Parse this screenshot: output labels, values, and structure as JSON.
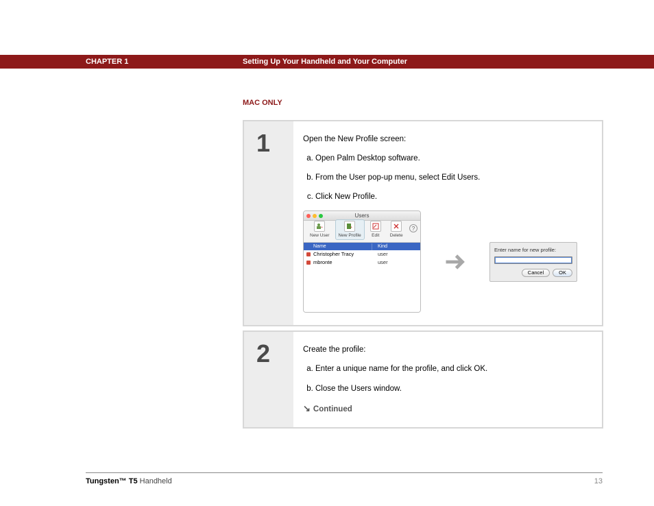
{
  "header": {
    "chapter": "CHAPTER 1",
    "title": "Setting Up Your Handheld and Your Computer"
  },
  "section_label": "MAC ONLY",
  "steps": [
    {
      "num": "1",
      "lead": "Open the New Profile screen:",
      "items": [
        "Open Palm Desktop software.",
        "From the User pop-up menu, select Edit Users.",
        "Click New Profile."
      ]
    },
    {
      "num": "2",
      "lead": "Create the profile:",
      "items": [
        "Enter a unique name for the profile, and click OK.",
        "Close the Users window."
      ],
      "continued": "Continued"
    }
  ],
  "users_window": {
    "title": "Users",
    "toolbar": [
      {
        "label": "New User",
        "selected": false
      },
      {
        "label": "New Profile",
        "selected": true
      },
      {
        "label": "Edit",
        "selected": false
      },
      {
        "label": "Delete",
        "selected": false
      }
    ],
    "columns": {
      "name": "Name",
      "kind": "Kind"
    },
    "rows": [
      {
        "name": "Christopher Tracy",
        "kind": "user"
      },
      {
        "name": "mbronte",
        "kind": "user"
      }
    ],
    "help": "?"
  },
  "profile_dialog": {
    "label": "Enter name for new profile:",
    "buttons": {
      "cancel": "Cancel",
      "ok": "OK"
    }
  },
  "footer": {
    "brand_bold": "Tungsten™ T5",
    "brand_rest": " Handheld",
    "page": "13"
  }
}
